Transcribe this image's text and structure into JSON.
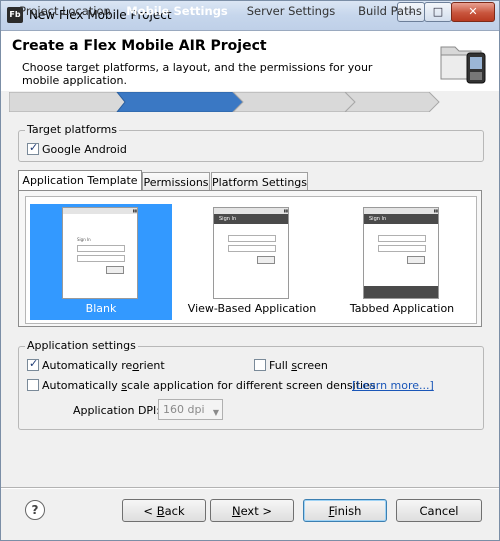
{
  "window": {
    "title": "New Flex Mobile Project",
    "app_icon": "Fb",
    "min": "–",
    "max": "□",
    "close": "✕"
  },
  "header": {
    "title": "Create a Flex Mobile AIR Project",
    "description": "Choose target platforms, a layout, and the permissions for your mobile application."
  },
  "steps": [
    "Project Location",
    "Mobile Settings",
    "Server Settings",
    "Build Paths"
  ],
  "target_platforms": {
    "label": "Target platforms",
    "google_android": "Google Android",
    "google_android_checked": true
  },
  "tabs": [
    "Application Template",
    "Permissions",
    "Platform Settings"
  ],
  "templates": [
    {
      "name": "Blank",
      "selected": true,
      "signin": "Sign In"
    },
    {
      "name": "View-Based Application",
      "selected": false,
      "signin": "Sign In"
    },
    {
      "name": "Tabbed Application",
      "selected": false,
      "signin": "Sign In"
    }
  ],
  "app_settings": {
    "label": "Application settings",
    "reorient_pre": "Automatically re",
    "reorient_u": "o",
    "reorient_post": "rient",
    "reorient_checked": true,
    "fullscreen_pre": "Full ",
    "fullscreen_u": "s",
    "fullscreen_post": "creen",
    "fullscreen_checked": false,
    "scale_pre": "Automatically ",
    "scale_u": "s",
    "scale_post": "cale application for different screen densities",
    "scale_checked": false,
    "learn_more": "[Learn more...]",
    "dpi_label": "Application DPI:",
    "dpi_value": "160 dpi"
  },
  "buttons": {
    "help": "?",
    "back_pre": "< ",
    "back_u": "B",
    "back_post": "ack",
    "next_u": "N",
    "next_post": "ext >",
    "finish_u": "F",
    "finish_post": "inish",
    "cancel": "Cancel"
  },
  "colors": {
    "selection": "#3399ff",
    "step_active": "#3a78c4",
    "link": "#1a56b8"
  }
}
